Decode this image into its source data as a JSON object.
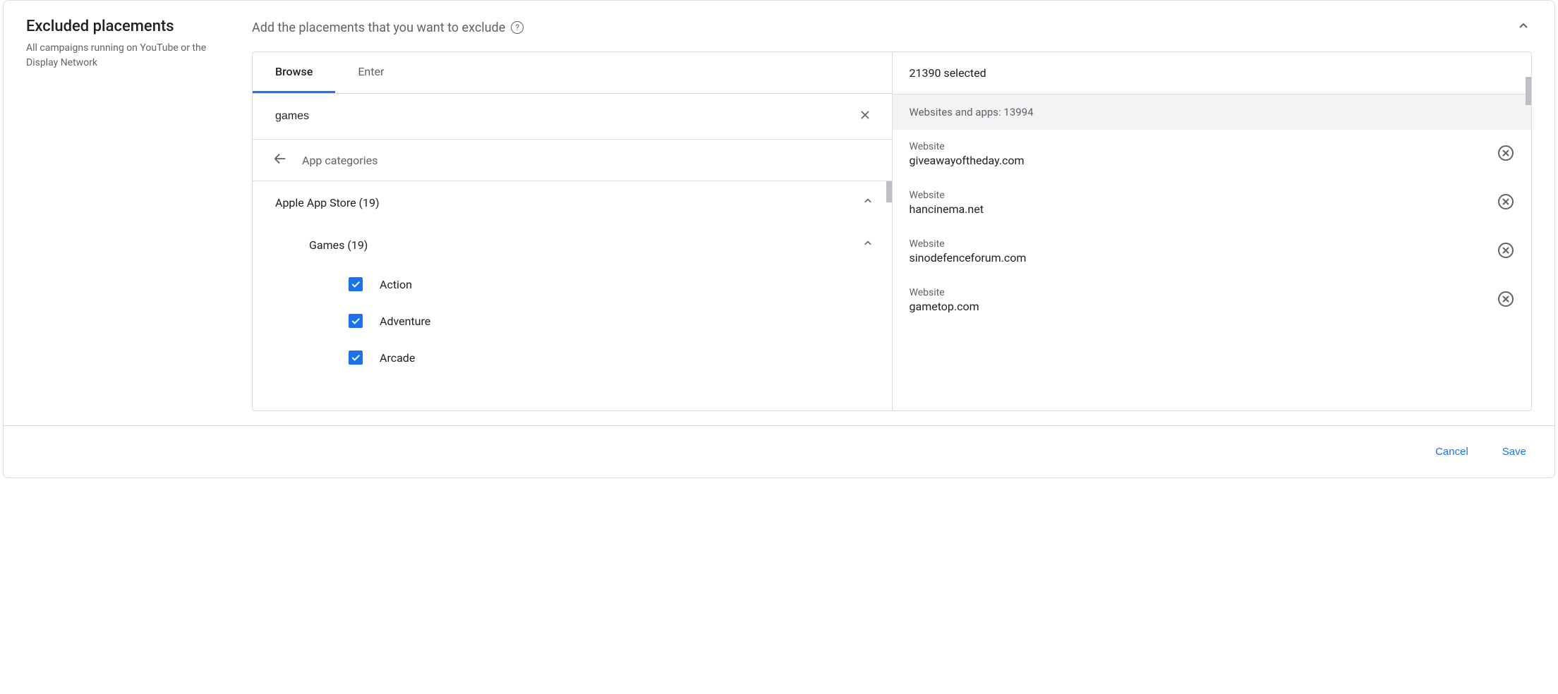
{
  "section": {
    "title": "Excluded placements",
    "subtitle": "All campaigns running on YouTube or the Display Network",
    "instruction": "Add the placements that you want to exclude"
  },
  "tabs": {
    "browse": "Browse",
    "enter": "Enter"
  },
  "search": {
    "value": "games"
  },
  "breadcrumb": {
    "label": "App categories"
  },
  "tree": {
    "store": "Apple App Store (19)",
    "games": "Games (19)",
    "items": [
      {
        "label": "Action",
        "checked": true
      },
      {
        "label": "Adventure",
        "checked": true
      },
      {
        "label": "Arcade",
        "checked": true
      }
    ]
  },
  "selected": {
    "count_label": "21390 selected",
    "group_label": "Websites and apps: 13994",
    "items": [
      {
        "type": "Website",
        "value": "giveawayoftheday.com"
      },
      {
        "type": "Website",
        "value": "hancinema.net"
      },
      {
        "type": "Website",
        "value": "sinodefenceforum.com"
      },
      {
        "type": "Website",
        "value": "gametop.com"
      }
    ]
  },
  "footer": {
    "cancel": "Cancel",
    "save": "Save"
  }
}
